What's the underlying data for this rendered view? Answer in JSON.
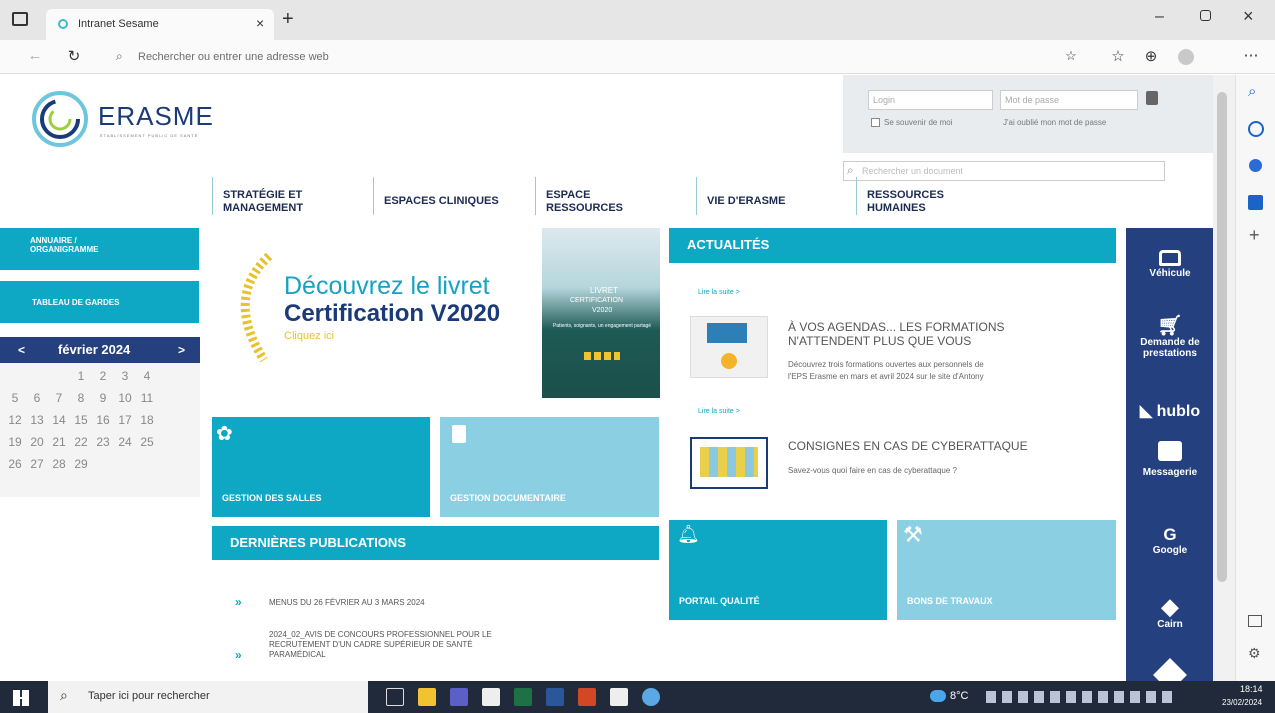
{
  "browser": {
    "tab_title": "Intranet Sesame",
    "address_placeholder": "Rechercher ou entrer une adresse web"
  },
  "header": {
    "logo_text": "ERASME",
    "logo_subtitle": "ÉTABLISSEMENT PUBLIC DE SANTÉ",
    "login_placeholder": "Login",
    "password_placeholder": "Mot de passe",
    "remember_label": "Se souvenir de moi",
    "forgot_link": "J'ai oublié mon mot de passe",
    "search_placeholder": "Rechercher un document"
  },
  "nav": [
    {
      "line1": "STRATÉGIE ET",
      "line2": "MANAGEMENT"
    },
    {
      "line1": "ESPACES CLINIQUES",
      "line2": ""
    },
    {
      "line1": "ESPACE",
      "line2": "RESSOURCES"
    },
    {
      "line1": "VIE D'ERASME",
      "line2": ""
    },
    {
      "line1": "RESSOURCES",
      "line2": "HUMAINES"
    }
  ],
  "left": {
    "annuaire_l1": "ANNUAIRE /",
    "annuaire_l2": "ORGANIGRAMME",
    "gardes": "TABLEAU DE GARDES",
    "calendar_month": "février 2024",
    "calendar_prev": "<",
    "calendar_next": ">",
    "calendar_rows": [
      [
        "",
        "",
        "",
        "1",
        "2",
        "3",
        "4"
      ],
      [
        "5",
        "6",
        "7",
        "8",
        "9",
        "10",
        "11"
      ],
      [
        "12",
        "13",
        "14",
        "15",
        "16",
        "17",
        "18"
      ],
      [
        "19",
        "20",
        "21",
        "22",
        "23",
        "24",
        "25"
      ],
      [
        "26",
        "27",
        "28",
        "29",
        "",
        "",
        ""
      ]
    ]
  },
  "banner": {
    "line1": "Découvrez le livret",
    "line2": "Certification V2020",
    "line3": "Cliquez ici",
    "book_l1": "LIVRET",
    "book_l2": "CERTIFICATION",
    "book_l3": "V2020",
    "book_sub": "Patients, soignants, un engagement partagé"
  },
  "tiles": {
    "salles": "GESTION DES SALLES",
    "documentaire": "GESTION DOCUMENTAIRE",
    "qualite": "PORTAIL QUALITÉ",
    "travaux": "BONS DE TRAVAUX"
  },
  "news": {
    "title": "ACTUALITÉS",
    "read_more": "Lire la suite >",
    "items": [
      {
        "title_l1": "À VOS AGENDAS... LES FORMATIONS",
        "title_l2": "N'ATTENDENT PLUS QUE VOUS",
        "desc_l1": "Découvrez trois formations ouvertes aux personnels de",
        "desc_l2": "l'EPS Erasme en mars et avril 2024 sur le site d'Antony"
      },
      {
        "title_l1": "CONSIGNES EN CAS DE CYBERATTAQUE",
        "title_l2": "",
        "desc_l1": "Savez-vous quoi faire en cas de cyberattaque ?",
        "desc_l2": ""
      }
    ]
  },
  "publications": {
    "title": "DERNIÈRES PUBLICATIONS",
    "items": [
      {
        "l1": "MENUS DU 26 FÉVRIER AU 3 MARS 2024",
        "l2": "",
        "l3": ""
      },
      {
        "l1": "2024_02_AVIS DE CONCOURS PROFESSIONNEL POUR LE",
        "l2": "RECRUTEMENT D'UN CADRE SUPÉRIEUR DE SANTÉ",
        "l3": "PARAMÉDICAL"
      }
    ]
  },
  "services": [
    {
      "l1": "Véhicule",
      "l2": ""
    },
    {
      "l1": "Demande de",
      "l2": "prestations"
    },
    {
      "l1": "hublo",
      "l2": ""
    },
    {
      "l1": "Messagerie",
      "l2": ""
    },
    {
      "l1": "Google",
      "l2": ""
    },
    {
      "l1": "Cairn",
      "l2": ""
    }
  ],
  "taskbar": {
    "search_placeholder": "Taper ici pour rechercher",
    "temp": "8°C",
    "time": "18:14",
    "date": "23/02/2024"
  },
  "colors": {
    "teal": "#0fa8c4",
    "light_teal": "#8ad0e2",
    "navy": "#25407e",
    "taskbar": "#202a3a"
  }
}
